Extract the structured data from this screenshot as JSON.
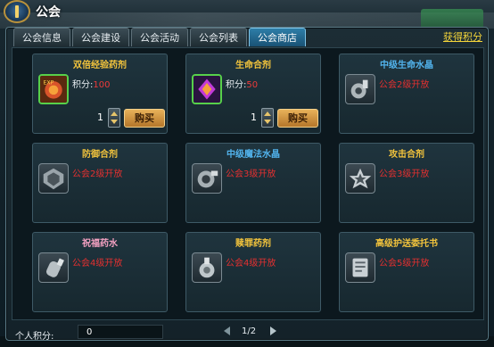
{
  "window": {
    "title": "公会"
  },
  "tabs": [
    {
      "label": "公会信息",
      "active": false
    },
    {
      "label": "公会建设",
      "active": false
    },
    {
      "label": "公会活动",
      "active": false
    },
    {
      "label": "公会列表",
      "active": false
    },
    {
      "label": "公会商店",
      "active": true
    }
  ],
  "get_points_link": "获得积分",
  "shop": {
    "items": [
      {
        "name": "双倍经验药剂",
        "points_label": "积分:",
        "points": "100",
        "qty": "1",
        "buy_label": "购买",
        "icon": "exp-potion-icon"
      },
      {
        "name": "生命合剂",
        "points_label": "积分:",
        "points": "50",
        "qty": "1",
        "buy_label": "购买",
        "icon": "life-crystal-icon"
      },
      {
        "name": "中级生命水晶",
        "lock_text": "公会2级开放",
        "icon": "potion-bottle-icon"
      },
      {
        "name": "防御合剂",
        "lock_text": "公会2级开放",
        "icon": "shield-crest-icon"
      },
      {
        "name": "中级魔法水晶",
        "lock_text": "公会3级开放",
        "icon": "mana-orb-icon"
      },
      {
        "name": "攻击合剂",
        "lock_text": "公会3级开放",
        "icon": "star-crest-icon"
      },
      {
        "name": "祝福药水",
        "lock_text": "公会4级开放",
        "icon": "bless-vial-icon"
      },
      {
        "name": "赎罪药剂",
        "lock_text": "公会4级开放",
        "icon": "redemption-flask-icon"
      },
      {
        "name": "高级护送委托书",
        "lock_text": "公会5级开放",
        "icon": "scroll-icon"
      }
    ]
  },
  "footer": {
    "points_label": "个人积分:",
    "points_value": "0",
    "page_indicator": "1/2"
  },
  "colors": {
    "gold": "#f3c43c",
    "blue": "#52b4ee",
    "pink": "#f2a0c0",
    "locked_red": "#e43030",
    "accent": "#2e7ea8"
  }
}
